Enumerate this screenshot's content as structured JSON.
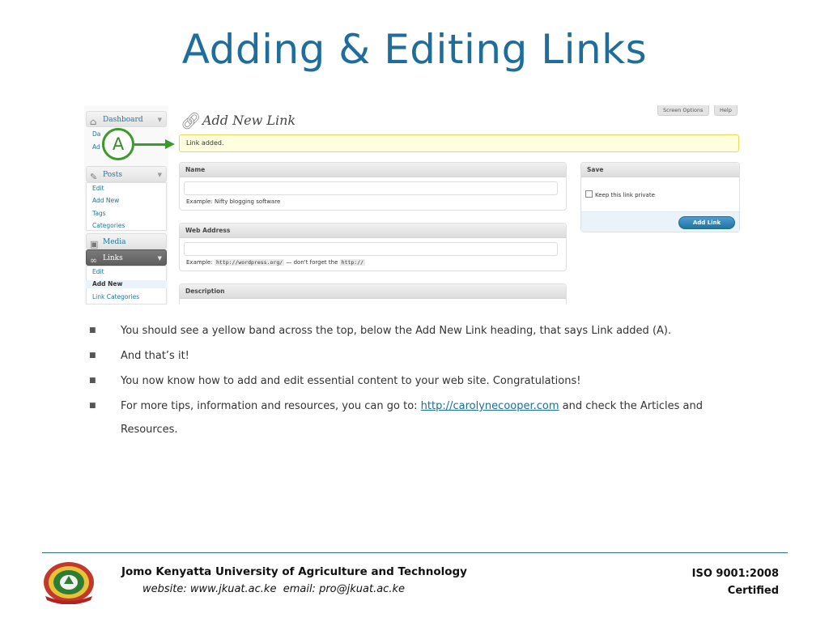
{
  "slide": {
    "title": "Adding & Editing Links"
  },
  "screenshot": {
    "sidebar": {
      "dashboard": "Dashboard",
      "dashboard_items": [
        "Da",
        "Ad"
      ],
      "posts": "Posts",
      "posts_items": [
        "Edit",
        "Add New",
        "Tags",
        "Categories"
      ],
      "media": "Media",
      "links": "Links",
      "links_items": [
        "Edit",
        "Add New",
        "Link Categories"
      ]
    },
    "page_heading": "Add New Link",
    "screen_options": "Screen Options",
    "help": "Help",
    "notice": "Link added.",
    "name_box": {
      "title": "Name",
      "example": "Example: Nifty blogging software"
    },
    "web_address_box": {
      "title": "Web Address",
      "example_prefix": "Example:",
      "example_url": "http://wordpress.org/",
      "example_middle": "— don't forget the",
      "example_code": "http://"
    },
    "description_box": {
      "title": "Description"
    },
    "save_box": {
      "title": "Save",
      "private_label": "Keep this link private",
      "button": "Add Link"
    },
    "callout_label": "A"
  },
  "bullets": {
    "b1": "You should see a yellow band across the top, below the Add New Link heading, that says Link added (A).",
    "b2": "And that’s it!",
    "b3": "You now know how to add and edit essential content to your web site. Congratulations!",
    "b4_prefix": "For more tips, information and resources, you can go to: ",
    "b4_link": "http://carolynecooper.com",
    "b4_suffix": " and check the Articles and Resources."
  },
  "footer": {
    "university": "Jomo Kenyatta University of Agriculture and Technology",
    "website_label": "website:",
    "website": "www.jkuat.ac.ke",
    "email_label": "email:",
    "email": "pro@jkuat.ac.ke",
    "iso_line1": "ISO 9001:2008",
    "iso_line2": "Certified"
  },
  "colors": {
    "title": "#1f6d9b",
    "accent_green": "#3a9a2a",
    "notice_bg": "#ffffe0",
    "link": "#1a6ea0"
  }
}
